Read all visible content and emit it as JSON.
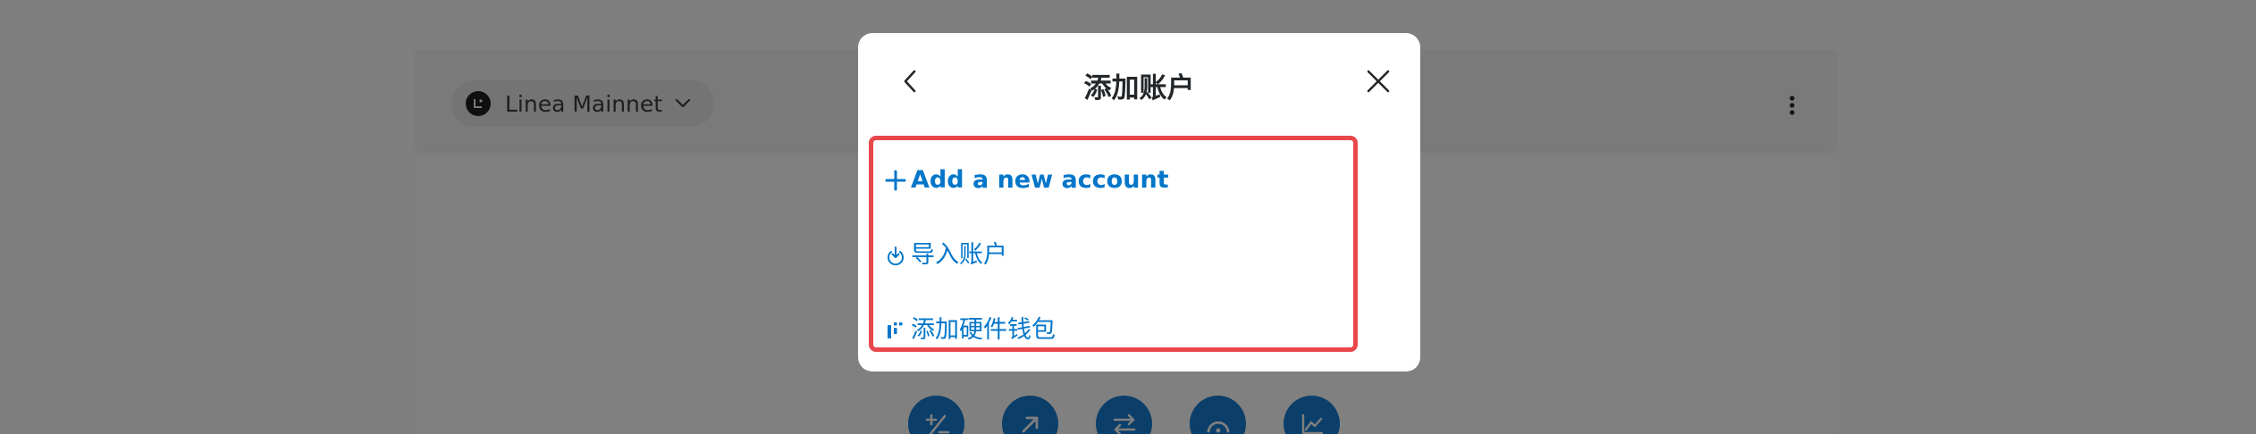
{
  "background_app": {
    "network": {
      "name": "Linea Mainnet",
      "logo_icon": "linea-logo-icon",
      "chevron_icon": "chevron-down-icon"
    },
    "menu_icon": "kebab-menu-icon",
    "action_icons": [
      "buy-sell-icon",
      "send-icon",
      "swap-icon",
      "bridge-icon",
      "portfolio-icon"
    ]
  },
  "modal": {
    "title": "添加账户",
    "back_icon": "chevron-left-icon",
    "close_icon": "close-icon",
    "options": {
      "add_new_account": "Add a new account",
      "import_account": "导入账户",
      "add_hardware_wallet": "添加硬件钱包"
    }
  },
  "colors": {
    "accent": "#0376c9",
    "highlight_border": "#e8474c",
    "overlay": "#7f7f7f",
    "action_button": "#0b3f6a"
  }
}
